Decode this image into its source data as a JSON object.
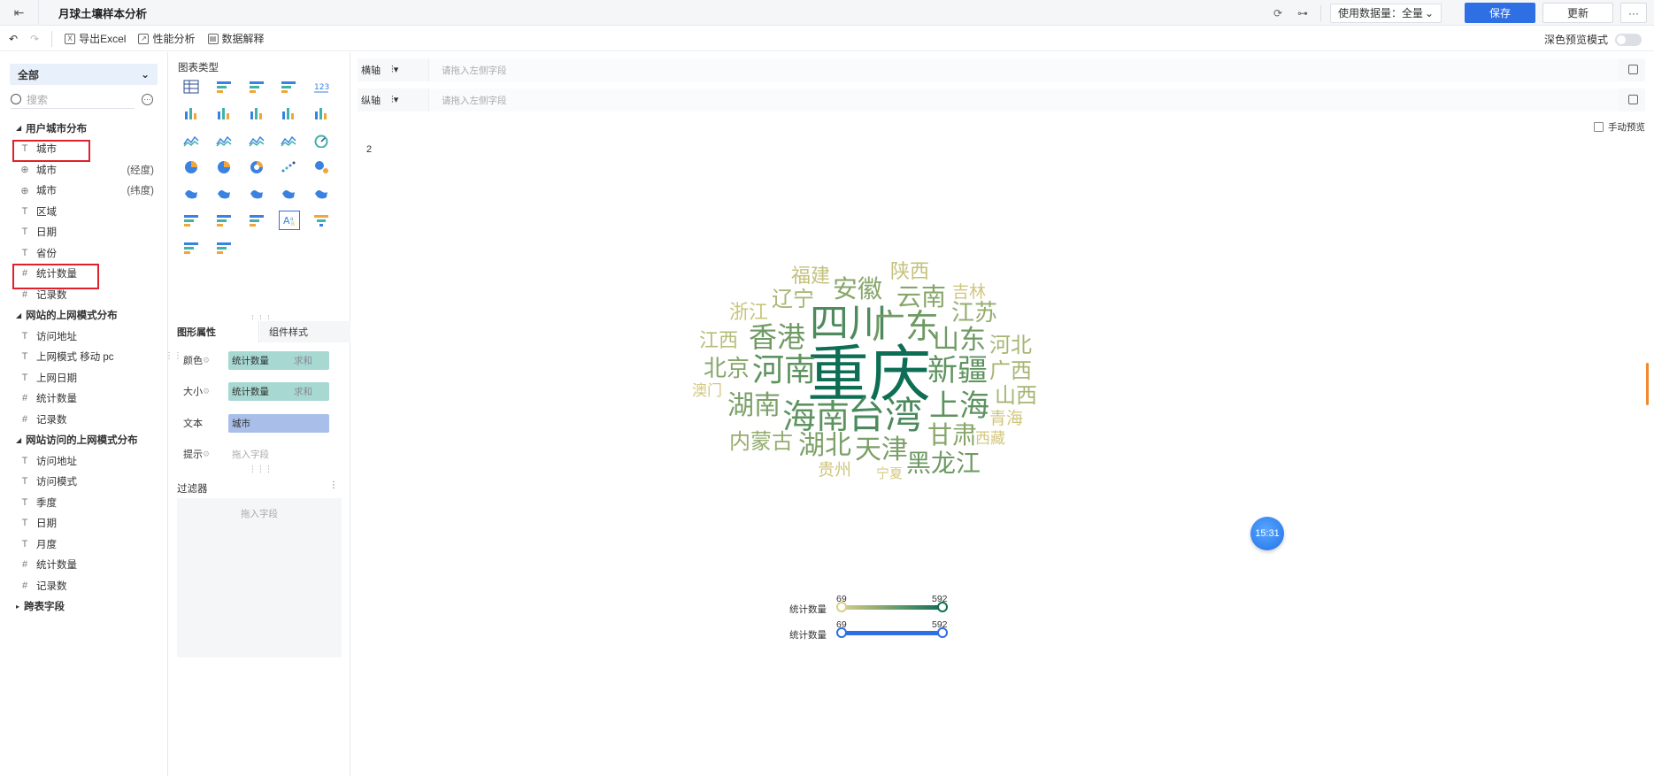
{
  "header": {
    "title": "月球土壤样本分析",
    "data_amount_label": "使用数据量：全量",
    "save_label": "保存",
    "update_label": "更新",
    "more_label": "···"
  },
  "toolbar": {
    "export_excel": "导出Excel",
    "performance": "性能分析",
    "data_explain": "数据解释",
    "dark_preview": "深色预览模式"
  },
  "left": {
    "select_all": "全部",
    "search_placeholder": "搜索",
    "groups": [
      {
        "title": "用户城市分布",
        "fields": [
          {
            "type": "T",
            "label": "城市",
            "suffix": ""
          },
          {
            "type": "globe",
            "label": "城市",
            "suffix": "(经度)"
          },
          {
            "type": "globe",
            "label": "城市",
            "suffix": "(纬度)"
          },
          {
            "type": "T",
            "label": "区域",
            "suffix": ""
          },
          {
            "type": "T",
            "label": "日期",
            "suffix": ""
          },
          {
            "type": "T",
            "label": "省份",
            "suffix": ""
          },
          {
            "type": "#",
            "label": "统计数量",
            "suffix": ""
          },
          {
            "type": "#*",
            "label": "记录数",
            "suffix": ""
          }
        ]
      },
      {
        "title": "网站的上网模式分布",
        "fields": [
          {
            "type": "T",
            "label": "访问地址",
            "suffix": ""
          },
          {
            "type": "T",
            "label": "上网模式 移动 pc",
            "suffix": ""
          },
          {
            "type": "T",
            "label": "上网日期",
            "suffix": ""
          },
          {
            "type": "#",
            "label": "统计数量",
            "suffix": ""
          },
          {
            "type": "#*",
            "label": "记录数",
            "suffix": ""
          }
        ]
      },
      {
        "title": "网站访问的上网模式分布",
        "fields": [
          {
            "type": "T",
            "label": "访问地址",
            "suffix": ""
          },
          {
            "type": "T",
            "label": "访问模式",
            "suffix": ""
          },
          {
            "type": "T",
            "label": "季度",
            "suffix": ""
          },
          {
            "type": "T",
            "label": "日期",
            "suffix": ""
          },
          {
            "type": "T",
            "label": "月度",
            "suffix": ""
          },
          {
            "type": "#",
            "label": "统计数量",
            "suffix": ""
          },
          {
            "type": "#*",
            "label": "记录数",
            "suffix": ""
          }
        ]
      },
      {
        "title": "跨表字段",
        "fields": []
      }
    ]
  },
  "middle": {
    "chart_type_title": "图表类型",
    "tab_active": "图形属性",
    "tab_inactive": "组件样式",
    "props": [
      {
        "label": "颜色",
        "field": "统计数量",
        "agg": "求和",
        "color": "#a7d8d2"
      },
      {
        "label": "大小",
        "field": "统计数量",
        "agg": "求和",
        "color": "#a7d8d2"
      },
      {
        "label": "文本",
        "field": "城市",
        "agg": "",
        "color": "#a9bfea"
      },
      {
        "label": "提示",
        "field": "",
        "agg": "",
        "placeholder": "拖入字段"
      }
    ],
    "filter_title": "过滤器",
    "filter_placeholder": "拖入字段"
  },
  "axes": {
    "x_label": "横轴",
    "y_label": "纵轴",
    "placeholder": "请拖入左侧字段",
    "manual_preview": "手动预览"
  },
  "chart_data": {
    "type": "wordcloud",
    "result_count": "2",
    "words": [
      {
        "text": "重庆",
        "size": 70,
        "color": "#0e6e55"
      },
      {
        "text": "四川",
        "size": 44,
        "color": "#4f8a5e"
      },
      {
        "text": "广东",
        "size": 38,
        "color": "#6f9a63"
      },
      {
        "text": "台湾",
        "size": 42,
        "color": "#4b8a5c"
      },
      {
        "text": "海南",
        "size": 38,
        "color": "#5e935f"
      },
      {
        "text": "河南",
        "size": 36,
        "color": "#5e935f"
      },
      {
        "text": "新疆",
        "size": 34,
        "color": "#5e935f"
      },
      {
        "text": "上海",
        "size": 34,
        "color": "#5e935f"
      },
      {
        "text": "香港",
        "size": 32,
        "color": "#6f9a63"
      },
      {
        "text": "山东",
        "size": 30,
        "color": "#6f9a63"
      },
      {
        "text": "湖南",
        "size": 30,
        "color": "#7ba067"
      },
      {
        "text": "湖北",
        "size": 30,
        "color": "#7ba067"
      },
      {
        "text": "天津",
        "size": 30,
        "color": "#7ba067"
      },
      {
        "text": "黑龙江",
        "size": 28,
        "color": "#6f9a63"
      },
      {
        "text": "安徽",
        "size": 28,
        "color": "#86a66a"
      },
      {
        "text": "云南",
        "size": 28,
        "color": "#86a66a"
      },
      {
        "text": "甘肃",
        "size": 28,
        "color": "#86a66a"
      },
      {
        "text": "江苏",
        "size": 26,
        "color": "#95ac6e"
      },
      {
        "text": "北京",
        "size": 26,
        "color": "#86a66a"
      },
      {
        "text": "内蒙古",
        "size": 24,
        "color": "#95ac6e"
      },
      {
        "text": "辽宁",
        "size": 24,
        "color": "#a6b573"
      },
      {
        "text": "广西",
        "size": 24,
        "color": "#a6b573"
      },
      {
        "text": "山西",
        "size": 24,
        "color": "#a6b573"
      },
      {
        "text": "河北",
        "size": 24,
        "color": "#a6b573"
      },
      {
        "text": "江西",
        "size": 22,
        "color": "#b6bc78"
      },
      {
        "text": "陕西",
        "size": 22,
        "color": "#c3c17b"
      },
      {
        "text": "福建",
        "size": 22,
        "color": "#c3c17b"
      },
      {
        "text": "浙江",
        "size": 22,
        "color": "#c9c47c"
      },
      {
        "text": "吉林",
        "size": 19,
        "color": "#d0c67d"
      },
      {
        "text": "青海",
        "size": 19,
        "color": "#d0c67d"
      },
      {
        "text": "贵州",
        "size": 19,
        "color": "#d0c67d"
      },
      {
        "text": "西藏",
        "size": 17,
        "color": "#d3c77e"
      },
      {
        "text": "澳门",
        "size": 17,
        "color": "#d3c77e"
      },
      {
        "text": "宁夏",
        "size": 15,
        "color": "#d6c97f"
      }
    ],
    "legend": [
      {
        "name": "统计数量",
        "min": "69",
        "max": "592",
        "gradient": [
          "#d9cf86",
          "#0e6e55"
        ]
      },
      {
        "name": "统计数量",
        "min": "69",
        "max": "592",
        "gradient": [
          "#2f6fe4",
          "#2f6fe4"
        ]
      }
    ]
  },
  "clock": "15:31"
}
